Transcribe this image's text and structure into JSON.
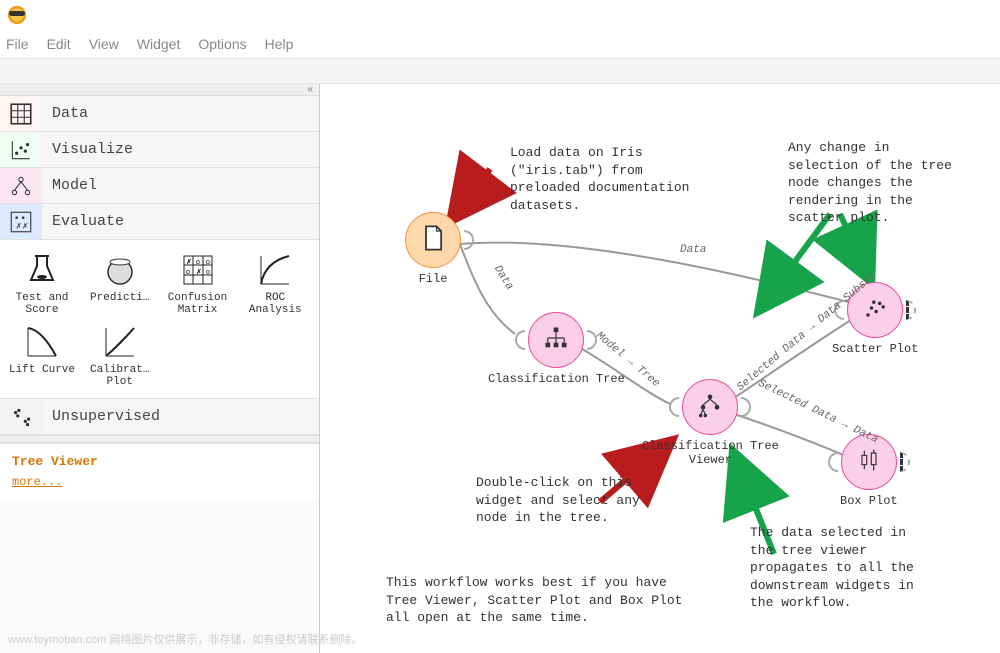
{
  "menubar": {
    "file": "File",
    "edit": "Edit",
    "view": "View",
    "widget": "Widget",
    "options": "Options",
    "help": "Help"
  },
  "sidebar": {
    "collapse_glyph": "«",
    "categories": [
      {
        "label": "Data"
      },
      {
        "label": "Visualize"
      },
      {
        "label": "Model"
      },
      {
        "label": "Evaluate"
      },
      {
        "label": "Unsupervised"
      }
    ],
    "widgets": [
      {
        "label": "Test and\nScore"
      },
      {
        "label": "Predicti…"
      },
      {
        "label": "Confusion\nMatrix"
      },
      {
        "label": "ROC\nAnalysis"
      },
      {
        "label": "Lift Curve"
      },
      {
        "label": "Calibrat…\nPlot"
      }
    ],
    "desc": {
      "title": "Tree Viewer",
      "more": "more..."
    }
  },
  "canvas": {
    "nodes": {
      "file": "File",
      "ctree": "Classification Tree",
      "ctview": "Classification Tree\nViewer",
      "scatter": "Scatter Plot",
      "box": "Box Plot"
    },
    "edges": {
      "data1": "Data",
      "data2": "Data",
      "model_tree": "Model → Tree",
      "sel_subset": "Selected Data → Data Subset",
      "sel_data": "Selected Data → Data"
    },
    "annotations": {
      "a1": "Load data on Iris (\"iris.tab\") from preloaded documentation datasets.",
      "a2": "Any change in selection of the tree node changes the rendering in the scatter plot.",
      "a3": "Double-click on this widget and select any node in the tree.",
      "a4": "The data selected in the tree viewer propagates to all the downstream widgets in the workflow.",
      "a5": "This workflow works best if you have Tree Viewer, Scatter Plot and Box Plot all open at the same time."
    }
  },
  "watermark": "www.toymoban.com 网络图片仅供展示，非存储，如有侵权请联系删除。"
}
